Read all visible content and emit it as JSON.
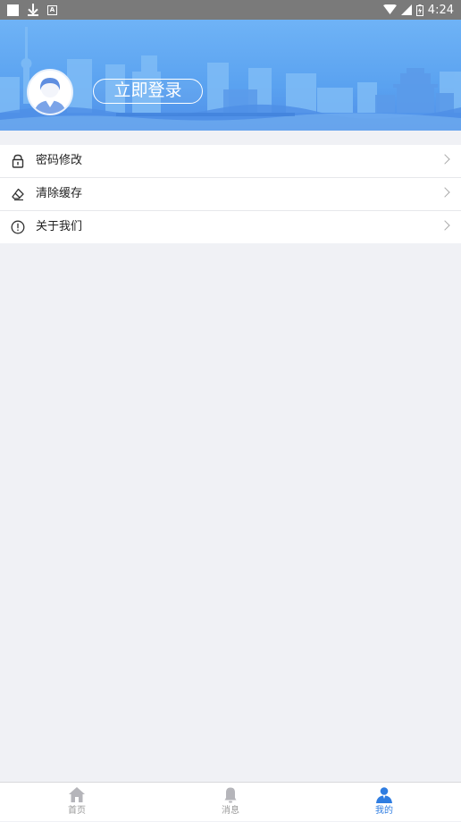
{
  "status_bar": {
    "time": "4:24"
  },
  "header": {
    "login_label": "立即登录"
  },
  "menu": {
    "items": [
      {
        "label": "密码修改",
        "icon": "lock-icon"
      },
      {
        "label": "清除缓存",
        "icon": "eraser-icon"
      },
      {
        "label": "关于我们",
        "icon": "info-icon"
      }
    ]
  },
  "bottom_nav": {
    "items": [
      {
        "label": "首页",
        "icon": "home-icon",
        "active": false
      },
      {
        "label": "消息",
        "icon": "bell-icon",
        "active": false
      },
      {
        "label": "我的",
        "icon": "profile-icon",
        "active": true
      }
    ]
  },
  "colors": {
    "accent": "#2f7de1",
    "header_blue": "#5aa2f0",
    "background": "#f0f1f5"
  }
}
